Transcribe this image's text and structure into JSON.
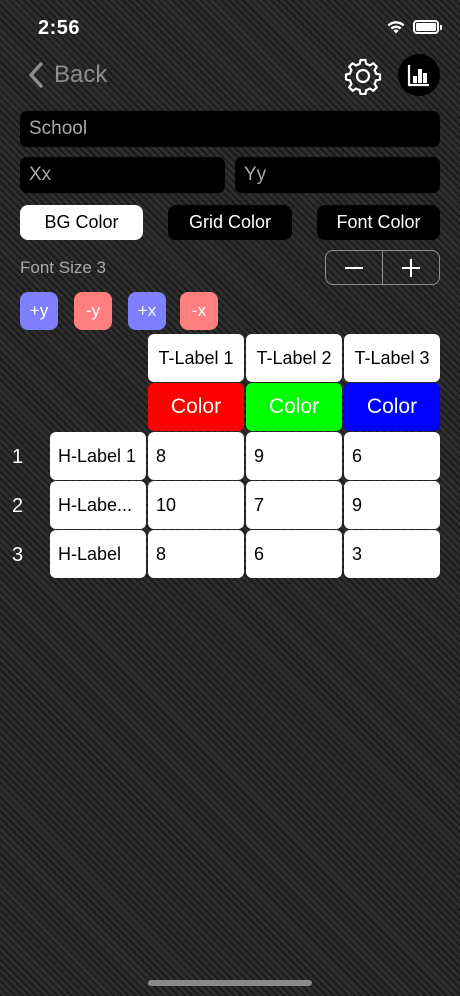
{
  "status_bar": {
    "time": "2:56"
  },
  "nav": {
    "back_label": "Back"
  },
  "fields": {
    "title_value": "School",
    "x_label_value": "Xx",
    "y_label_value": "Yy"
  },
  "color_buttons": {
    "bg": "BG Color",
    "grid": "Grid Color",
    "font": "Font Color"
  },
  "font_size": {
    "label": "Font Size 3",
    "minus": "—",
    "plus": "+"
  },
  "axis_buttons": {
    "plus_y": "+y",
    "minus_y": "-y",
    "plus_x": "+x",
    "minus_x": "-x"
  },
  "table": {
    "column_headers": [
      "T-Label 1",
      "T-Label 2",
      "T-Label 3"
    ],
    "color_row": {
      "label": "Color",
      "colors": [
        "#ff0000",
        "#00ff00",
        "#0000ff"
      ]
    },
    "row_numbers": [
      "1",
      "2",
      "3"
    ],
    "row_labels": [
      "H-Label 1",
      "H-Labe...",
      "H-Label"
    ],
    "rows": [
      [
        "8",
        "9",
        "6"
      ],
      [
        "10",
        "7",
        "9"
      ],
      [
        "8",
        "6",
        "3"
      ]
    ]
  },
  "icons": {
    "back": "chevron-left-icon",
    "settings": "gear-icon",
    "chart": "bar-chart-icon",
    "wifi": "wifi-icon",
    "battery": "battery-icon"
  }
}
